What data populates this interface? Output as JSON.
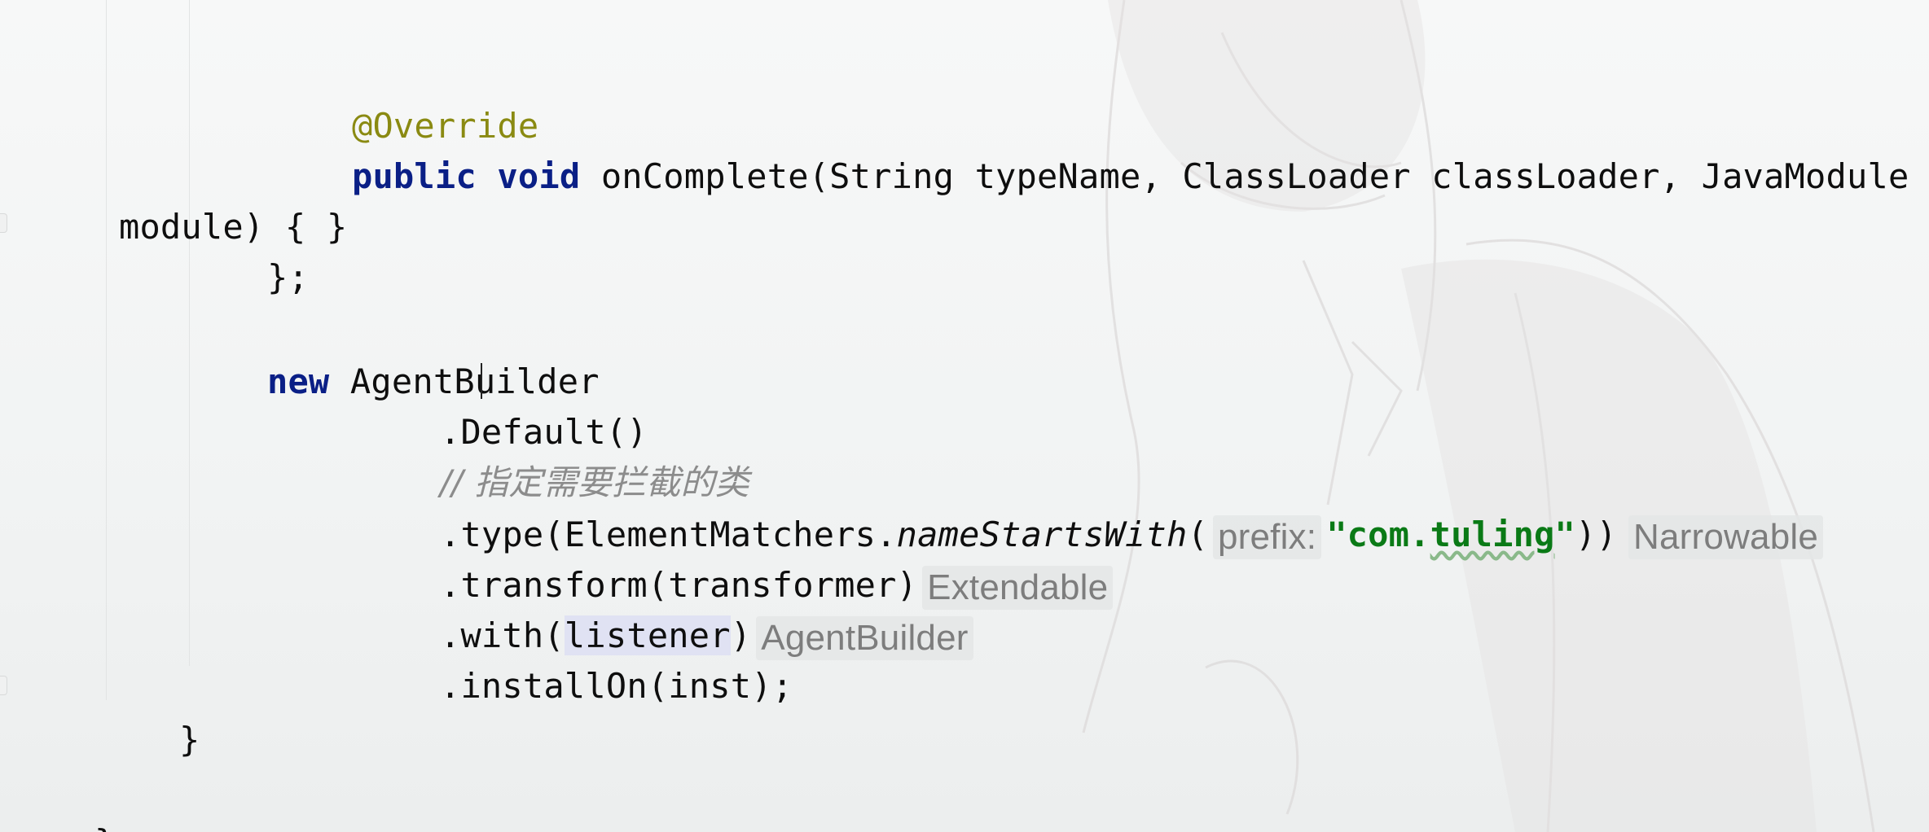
{
  "editor": {
    "lines": [
      {
        "annotation": "@Override"
      },
      {
        "kw_public": "public",
        "kw_void": "void",
        "signature": " onComplete(String typeName, ClassLoader classLoader, JavaModule"
      },
      {
        "text": "module) { }"
      },
      {
        "text": "};"
      },
      {
        "kw_new": "new",
        "text": " AgentBuilder"
      },
      {
        "text": ".Default()"
      },
      {
        "comment": "// 指定需要拦截的类"
      },
      {
        "prefix_call": ".type(ElementMatchers.",
        "method": "nameStartsWith",
        "paren_open": "(",
        "param_hint": "prefix:",
        "string_open": "\"com.",
        "string_word": "tuling",
        "string_close": "\"",
        "paren_close": "))",
        "type_hint": "Narrowable"
      },
      {
        "text": ".transform(transformer)",
        "type_hint": "Extendable"
      },
      {
        "prefix": ".with(",
        "highlighted": "listener",
        "suffix": ")",
        "type_hint": "AgentBuilder"
      },
      {
        "text": ".installOn(inst);"
      },
      {
        "text": "}"
      },
      {
        "text": "}"
      }
    ]
  },
  "colors": {
    "keyword": "#0a1f86",
    "annotation": "#8a8a12",
    "string": "#0a7a16",
    "comment": "#8c8c8c",
    "hint": "#7d7d7d"
  }
}
